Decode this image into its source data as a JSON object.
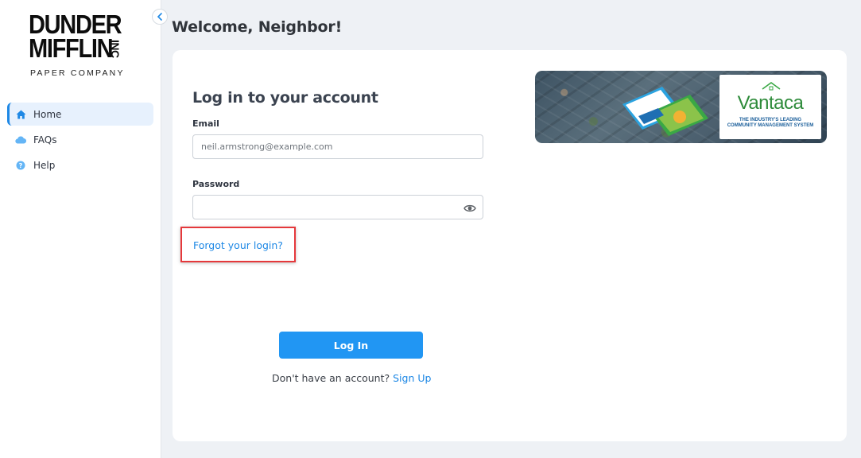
{
  "sidebar": {
    "logo": {
      "line1": "DUNDER",
      "line2": "MIFFLIN",
      "inc": "INC",
      "subtitle": "PAPER COMPANY"
    },
    "items": [
      {
        "label": "Home",
        "icon": "home-icon",
        "active": true
      },
      {
        "label": "FAQs",
        "icon": "cloud-icon",
        "active": false
      },
      {
        "label": "Help",
        "icon": "help-circle-icon",
        "active": false
      }
    ]
  },
  "header": {
    "title": "Welcome, Neighbor!"
  },
  "login": {
    "title": "Log in to your account",
    "email_label": "Email",
    "email_placeholder": "neil.armstrong@example.com",
    "password_label": "Password",
    "password_value": "",
    "forgot_link": "Forgot your login?",
    "login_button": "Log In",
    "signup_prompt": "Don't have an account?",
    "signup_link": "Sign Up"
  },
  "banner": {
    "brand": "Vantaca",
    "tagline": "THE INDUSTRY'S LEADING COMMUNITY MANAGEMENT SYSTEM"
  },
  "colors": {
    "accent": "#2196f3",
    "link": "#1e88e5",
    "highlight": "#e5383b",
    "brand_green": "#2e8b3a"
  }
}
